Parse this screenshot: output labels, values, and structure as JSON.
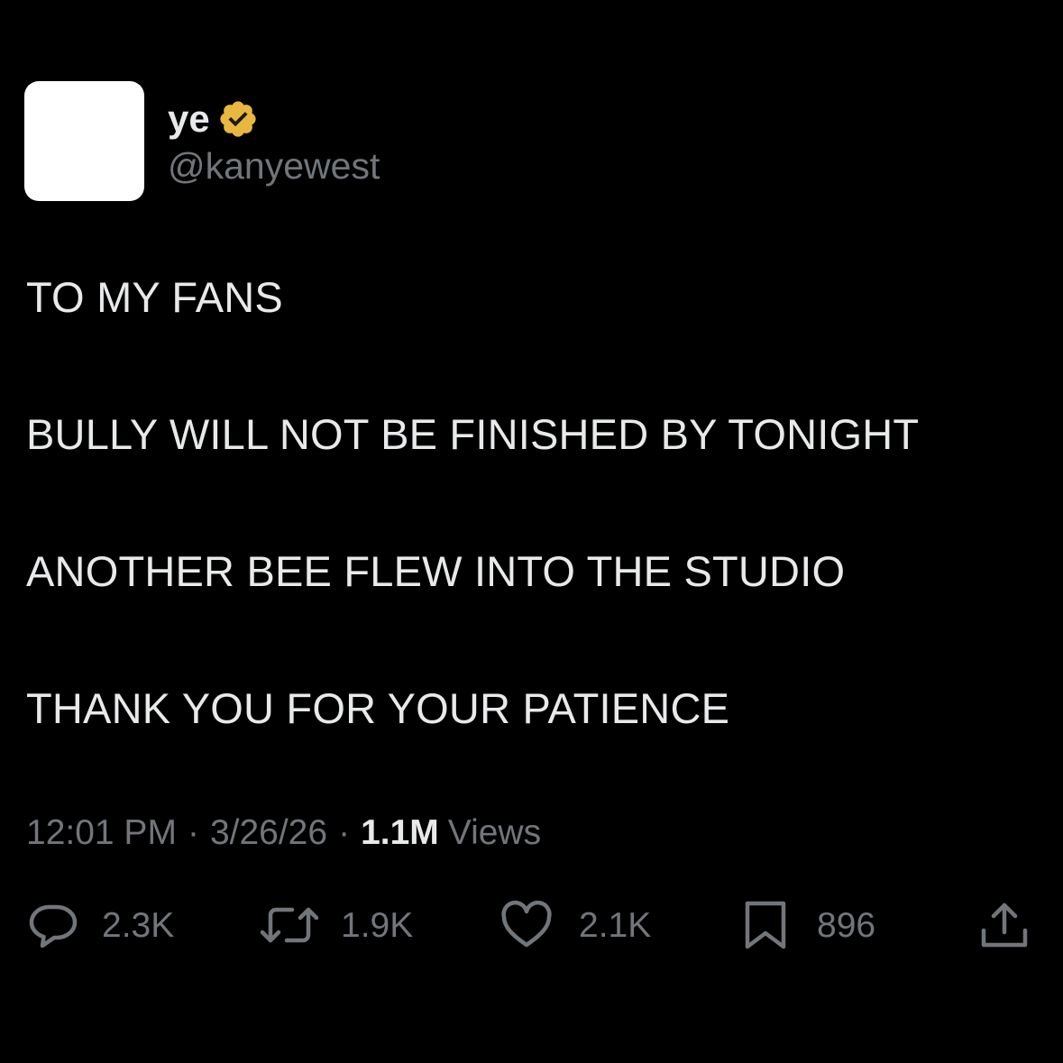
{
  "author": {
    "display_name": "ye",
    "handle": "@kanyewest",
    "verified_color": "#e8b73f"
  },
  "tweet": {
    "lines": [
      "TO MY FANS",
      "BULLY WILL NOT BE FINISHED BY TONIGHT",
      "ANOTHER BEE FLEW INTO THE STUDIO",
      "THANK YOU FOR YOUR PATIENCE"
    ]
  },
  "meta": {
    "time": "12:01 PM",
    "separator": "·",
    "date": "3/26/26",
    "views_count": "1.1M",
    "views_label": "Views"
  },
  "actions": {
    "replies": "2.3K",
    "reposts": "1.9K",
    "likes": "2.1K",
    "bookmarks": "896"
  },
  "icons": {
    "reply": "speech-bubble-icon",
    "repost": "repost-arrows-icon",
    "like": "heart-icon",
    "bookmark": "bookmark-icon",
    "share": "share-upload-icon",
    "verified": "verified-badge-icon"
  },
  "colors": {
    "background": "#000000",
    "text": "#e7e9ea",
    "muted": "#71767b",
    "badge": "#e8b73f"
  }
}
